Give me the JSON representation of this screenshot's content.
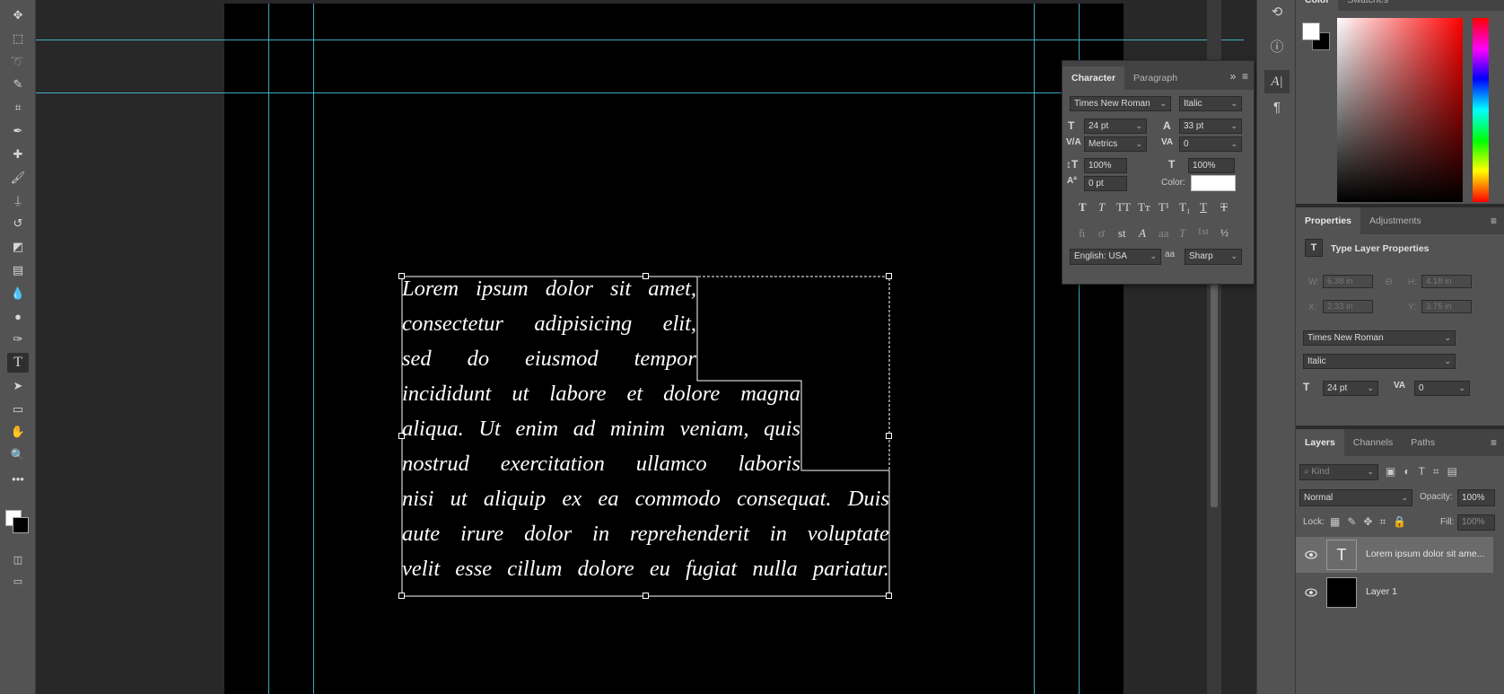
{
  "tools": [
    {
      "name": "move-tool-icon",
      "glyph": "✥"
    },
    {
      "name": "marquee-tool-icon",
      "glyph": "⬚"
    },
    {
      "name": "lasso-tool-icon",
      "glyph": "➰"
    },
    {
      "name": "quick-select-tool-icon",
      "glyph": "✎"
    },
    {
      "name": "crop-tool-icon",
      "glyph": "⌗"
    },
    {
      "name": "eyedropper-tool-icon",
      "glyph": "✒"
    },
    {
      "name": "healing-brush-tool-icon",
      "glyph": "✚"
    },
    {
      "name": "brush-tool-icon",
      "glyph": "🖌"
    },
    {
      "name": "clone-stamp-tool-icon",
      "glyph": "⍊"
    },
    {
      "name": "history-brush-tool-icon",
      "glyph": "↺"
    },
    {
      "name": "eraser-tool-icon",
      "glyph": "◩"
    },
    {
      "name": "gradient-tool-icon",
      "glyph": "▤"
    },
    {
      "name": "blur-tool-icon",
      "glyph": "💧"
    },
    {
      "name": "dodge-tool-icon",
      "glyph": "●"
    },
    {
      "name": "pen-tool-icon",
      "glyph": "✑"
    },
    {
      "name": "type-tool-icon",
      "glyph": "T"
    },
    {
      "name": "path-select-tool-icon",
      "glyph": "➤"
    },
    {
      "name": "shape-tool-icon",
      "glyph": "▭"
    },
    {
      "name": "hand-tool-icon",
      "glyph": "✋"
    },
    {
      "name": "zoom-tool-icon",
      "glyph": "🔍"
    },
    {
      "name": "more-tools-icon",
      "glyph": "•••"
    }
  ],
  "text_lines": [
    [
      "Lorem",
      "ipsum",
      "dolor",
      "sit",
      "amet,"
    ],
    [
      "consectetur",
      "adipisicing",
      "elit,"
    ],
    [
      "sed",
      "do",
      "eiusmod",
      "tempor"
    ],
    [
      "incididunt",
      "ut",
      "labore",
      "et",
      "dolore",
      "magna"
    ],
    [
      "aliqua.",
      "Ut",
      "enim",
      "ad",
      "minim",
      "veniam,",
      "quis"
    ],
    [
      "nostrud",
      "exercitation",
      "ullamco",
      "laboris"
    ],
    [
      "nisi",
      "ut",
      "aliquip",
      "ex",
      "ea",
      "commodo",
      "consequat.",
      "Duis"
    ],
    [
      "aute",
      "irure",
      "dolor",
      "in",
      "reprehenderit",
      "in",
      "voluptate"
    ],
    [
      "velit",
      "esse",
      "cillum",
      "dolore",
      "eu",
      "fugiat",
      "nulla",
      "pariatur."
    ]
  ],
  "character_panel": {
    "tab_character": "Character",
    "tab_paragraph": "Paragraph",
    "font_family": "Times New Roman",
    "font_style": "Italic",
    "font_size": "24 pt",
    "leading": "33 pt",
    "kerning": "Metrics",
    "tracking": "0",
    "vertical_scale": "100%",
    "horizontal_scale": "100%",
    "baseline_shift": "0 pt",
    "color_label": "Color:",
    "language": "English: USA",
    "antialias": "Sharp",
    "aa_label": "aa"
  },
  "right_panels": {
    "color_tab": "Color",
    "swatches_tab": "Swatches",
    "properties_tab": "Properties",
    "adjustments_tab": "Adjustments",
    "type_layer_properties": "Type Layer Properties",
    "w_label": "W:",
    "w_value": "6.38 in",
    "h_label": "H:",
    "h_value": "4.18 in",
    "x_label": "X:",
    "x_value": "2.33 in",
    "y_label": "Y:",
    "y_value": "3.75 in",
    "font_family": "Times New Roman",
    "font_style": "Italic",
    "font_size": "24 pt",
    "tracking": "0"
  },
  "layers_panel": {
    "layers_tab": "Layers",
    "channels_tab": "Channels",
    "paths_tab": "Paths",
    "kind_placeholder": "Kind",
    "blend_mode": "Normal",
    "opacity_label": "Opacity:",
    "opacity_value": "100%",
    "lock_label": "Lock:",
    "fill_label": "Fill:",
    "fill_value": "100%",
    "layers": [
      {
        "name": "Lorem ipsum dolor sit ame...",
        "type": "text",
        "selected": true
      },
      {
        "name": "Layer 1",
        "type": "pixel",
        "selected": false
      }
    ]
  },
  "colors": {
    "guide": "#46c8e0",
    "canvas": "#000000",
    "panel": "#535353",
    "foreground": "#ffffff",
    "background": "#000000"
  }
}
